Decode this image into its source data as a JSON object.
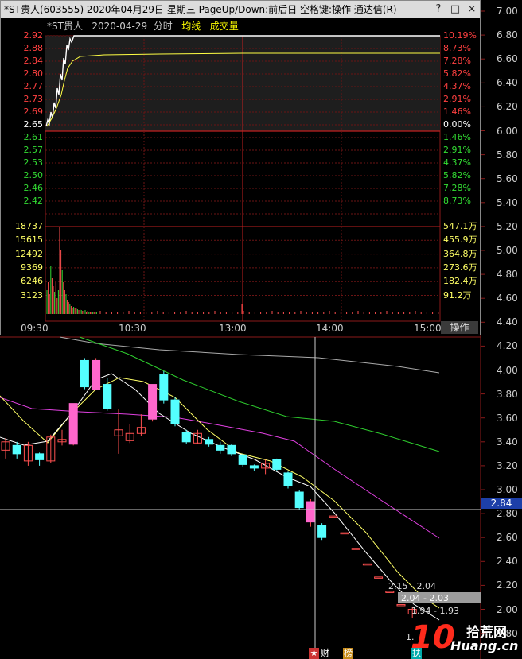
{
  "popup": {
    "title": "*ST贵人(603555) 2020年04月29日 星期三 PageUp/Down:前后日 空格键:操作 通达信(R)",
    "window_buttons": [
      "?",
      "□",
      "×"
    ],
    "header": {
      "stock": "*ST贵人",
      "date": "2020-04-29",
      "mode": "分时",
      "avg_label": "均线",
      "vol_label": "成交量"
    },
    "price_labels": [
      "2.92",
      "2.88",
      "2.84",
      "2.80",
      "2.77",
      "2.73",
      "2.69",
      "2.65",
      "2.61",
      "2.57",
      "2.53",
      "2.50",
      "2.46",
      "2.42"
    ],
    "pct_labels": [
      "10.19%",
      "8.73%",
      "7.28%",
      "5.82%",
      "4.37%",
      "2.91%",
      "1.46%",
      "0.00%",
      "1.46%",
      "2.91%",
      "4.37%",
      "5.82%",
      "7.28%",
      "8.73%"
    ],
    "volume_labels": [
      "18737",
      "15615",
      "12492",
      "9369",
      "6246",
      "3123"
    ],
    "amount_labels": [
      "547.1万",
      "455.9万",
      "364.8万",
      "273.6万",
      "182.4万",
      "91.2万"
    ],
    "time_labels": [
      "09:30",
      "10:30",
      "13:00",
      "14:00",
      "15:00"
    ],
    "operate_label": "操作"
  },
  "kline": {
    "y_axis": [
      "7.00",
      "6.80",
      "6.60",
      "6.40",
      "6.20",
      "6.00",
      "5.80",
      "5.60",
      "5.40",
      "5.20",
      "5.00",
      "4.80",
      "4.60",
      "4.40",
      "4.20",
      "4.00",
      "3.80",
      "3.60",
      "3.40",
      "3.20",
      "3.00",
      "2.80",
      "2.60",
      "2.40",
      "2.20",
      "2.00",
      "1.80"
    ],
    "crosshair_price": "2.84",
    "annotations": [
      "2.15 - 2.04",
      "2.04 - 2.03",
      "1.94 - 1.93",
      "1."
    ],
    "bottom_marks": [
      "★",
      "财",
      "榜",
      "扶"
    ],
    "candles": [
      {
        "o": 3.33,
        "c": 3.4,
        "h": 3.43,
        "l": 3.26
      },
      {
        "o": 3.37,
        "c": 3.3,
        "h": 3.4,
        "l": 3.26
      },
      {
        "o": 3.24,
        "c": 3.37,
        "h": 3.4,
        "l": 3.2
      },
      {
        "o": 3.3,
        "c": 3.25,
        "h": 3.31,
        "l": 3.2
      },
      {
        "o": 3.24,
        "c": 3.44,
        "h": 3.46,
        "l": 3.22
      },
      {
        "o": 3.4,
        "c": 3.42,
        "h": 3.5,
        "l": 3.37
      },
      {
        "o": 3.38,
        "c": 3.72,
        "h": 3.72,
        "l": 3.37
      },
      {
        "o": 4.08,
        "c": 3.86,
        "h": 4.1,
        "l": 3.84
      },
      {
        "o": 3.84,
        "c": 4.08,
        "h": 4.1,
        "l": 3.83
      },
      {
        "o": 3.88,
        "c": 3.68,
        "h": 3.93,
        "l": 3.66
      },
      {
        "o": 3.45,
        "c": 3.5,
        "h": 3.67,
        "l": 3.3
      },
      {
        "o": 3.41,
        "c": 3.47,
        "h": 3.55,
        "l": 3.39
      },
      {
        "o": 3.47,
        "c": 3.52,
        "h": 3.63,
        "l": 3.45
      },
      {
        "o": 3.59,
        "c": 3.88,
        "h": 3.88,
        "l": 3.57
      },
      {
        "o": 3.96,
        "c": 3.75,
        "h": 3.99,
        "l": 3.72
      },
      {
        "o": 3.75,
        "c": 3.55,
        "h": 3.77,
        "l": 3.53
      },
      {
        "o": 3.48,
        "c": 3.4,
        "h": 3.5,
        "l": 3.38
      },
      {
        "o": 3.39,
        "c": 3.47,
        "h": 3.5,
        "l": 3.38
      },
      {
        "o": 3.42,
        "c": 3.38,
        "h": 3.44,
        "l": 3.36
      },
      {
        "o": 3.37,
        "c": 3.33,
        "h": 3.4,
        "l": 3.3
      },
      {
        "o": 3.37,
        "c": 3.3,
        "h": 3.38,
        "l": 3.28
      },
      {
        "o": 3.29,
        "c": 3.21,
        "h": 3.3,
        "l": 3.19
      },
      {
        "o": 3.2,
        "c": 3.18,
        "h": 3.21,
        "l": 3.16
      },
      {
        "o": 3.18,
        "c": 3.22,
        "h": 3.25,
        "l": 3.13
      },
      {
        "o": 3.25,
        "c": 3.17,
        "h": 3.26,
        "l": 3.16
      },
      {
        "o": 3.14,
        "c": 3.03,
        "h": 3.15,
        "l": 3.01
      },
      {
        "o": 2.98,
        "c": 2.85,
        "h": 3.0,
        "l": 2.83
      },
      {
        "o": 2.73,
        "c": 2.9,
        "h": 2.92,
        "l": 2.69
      },
      {
        "o": 2.7,
        "c": 2.6,
        "h": 2.72,
        "l": 2.58
      },
      {
        "o": 2.78,
        "c": 2.78,
        "h": 2.78,
        "l": 2.78
      },
      {
        "o": 2.64,
        "c": 2.64,
        "h": 2.64,
        "l": 2.64
      },
      {
        "o": 2.51,
        "c": 2.51,
        "h": 2.51,
        "l": 2.51
      },
      {
        "o": 2.38,
        "c": 2.38,
        "h": 2.38,
        "l": 2.38
      },
      {
        "o": 2.27,
        "c": 2.27,
        "h": 2.27,
        "l": 2.27
      },
      {
        "o": 2.15,
        "c": 2.15,
        "h": 2.15,
        "l": 2.15
      },
      {
        "o": 2.04,
        "c": 2.04,
        "h": 2.04,
        "l": 2.04
      },
      {
        "o": 1.96,
        "c": 2.0,
        "h": 2.02,
        "l": 1.93
      }
    ]
  },
  "watermark": {
    "big": "10",
    "brand": "拾荒网",
    "site": "Huang.cn"
  }
}
